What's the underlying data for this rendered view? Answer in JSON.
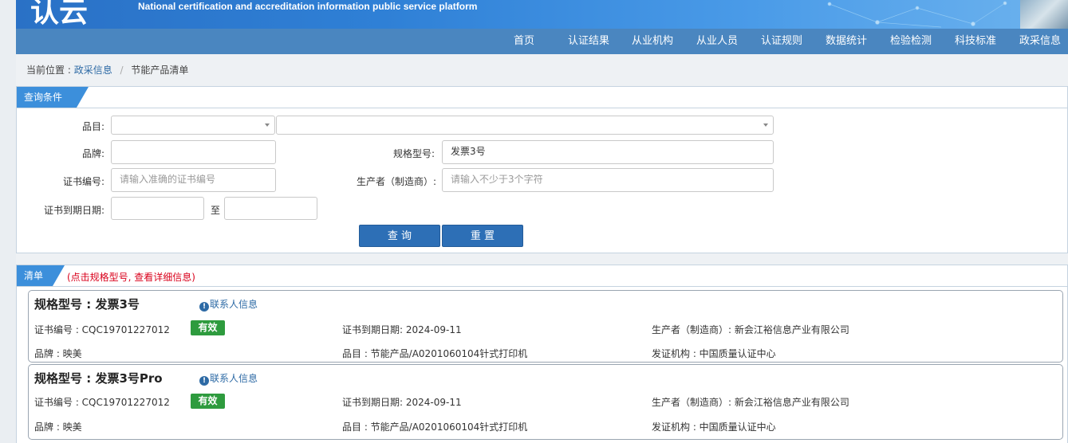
{
  "banner": {
    "logo_text": "认云",
    "subtitle": "National certification and accreditation information public service platform"
  },
  "nav": [
    "首页",
    "认证结果",
    "从业机构",
    "从业人员",
    "认证规则",
    "数据统计",
    "检验检测",
    "科技标准",
    "政采信息"
  ],
  "breadcrumb": {
    "label": "当前位置 :",
    "link": "政采信息",
    "sep": "/",
    "current": "节能产品清单"
  },
  "query_panel": {
    "title": "查询条件",
    "category_label": "品目:",
    "category_value_1": "",
    "category_value_2": "",
    "brand_label": "品牌:",
    "brand_value": "",
    "model_label": "规格型号:",
    "model_value": "发票3号",
    "cert_no_label": "证书编号:",
    "cert_no_placeholder": "请输入准确的证书编号",
    "manufacturer_label": "生产者（制造商）:",
    "manufacturer_placeholder": "请输入不少于3个字符",
    "expiry_label": "证书到期日期:",
    "expiry_from": "",
    "expiry_to_label": "至",
    "expiry_to": "",
    "search_button": "查 询",
    "reset_button": "重 置"
  },
  "list_panel": {
    "title": "清单",
    "hint": "(点击规格型号, 查看详细信息)",
    "items": [
      {
        "model": "规格型号 : 发票3号",
        "contact": "联系人信息",
        "cert_no": "证书编号 : CQC19701227012",
        "status": "有效",
        "expiry": "证书到期日期: 2024-09-11",
        "manufacturer": "生产者（制造商）: 新会江裕信息产业有限公司",
        "brand": "品牌 : 映美",
        "category": "品目 : 节能产品/A0201060104针式打印机",
        "issuer": "发证机构 : 中国质量认证中心"
      },
      {
        "model": "规格型号 : 发票3号Pro",
        "contact": "联系人信息",
        "cert_no": "证书编号 : CQC19701227012",
        "status": "有效",
        "expiry": "证书到期日期: 2024-09-11",
        "manufacturer": "生产者（制造商）: 新会江裕信息产业有限公司",
        "brand": "品牌 : 映美",
        "category": "品目 : 节能产品/A0201060104针式打印机",
        "issuer": "发证机构 : 中国质量认证中心"
      }
    ]
  },
  "colors": {
    "nav_bg": "#4a86c0",
    "accent": "#2d6fb6",
    "tab_bg": "#3c8fdb",
    "valid_badge": "#2e9b3e",
    "hint": "#d9001b"
  },
  "icons": {
    "info": "info-circle-icon",
    "caret": "chevron-down-icon"
  }
}
